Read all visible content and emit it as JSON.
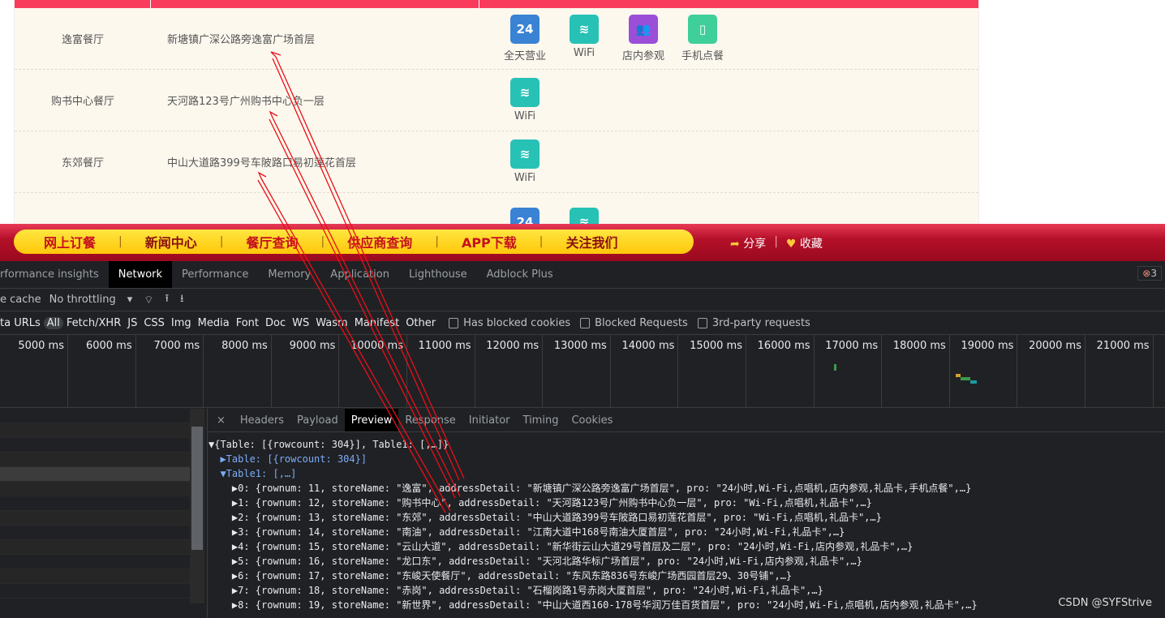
{
  "site": {
    "rows": [
      {
        "name": "逸富餐厅",
        "address": "新塘镇广深公路旁逸富广场首层",
        "features": [
          {
            "label": "全天营业",
            "icon": "24h-icon",
            "color": "#3a82d4"
          },
          {
            "label": "WiFi",
            "icon": "wifi-icon",
            "color": "#27c1b6"
          },
          {
            "label": "店内参观",
            "icon": "people-icon",
            "color": "#9b4fd8"
          },
          {
            "label": "手机点餐",
            "icon": "phone-icon",
            "color": "#3fcf9b"
          }
        ]
      },
      {
        "name": "购书中心餐厅",
        "address": "天河路123号广州购书中心负一层",
        "features": [
          {
            "label": "WiFi",
            "icon": "wifi-icon",
            "color": "#27c1b6"
          }
        ]
      },
      {
        "name": "东郊餐厅",
        "address": "中山大道路399号车陂路口易初莲花首层",
        "features": [
          {
            "label": "WiFi",
            "icon": "wifi-icon",
            "color": "#27c1b6"
          }
        ]
      }
    ],
    "nav": [
      "网上订餐",
      "新闻中心",
      "餐厅查询",
      "供应商查询",
      "APP下载",
      "关注我们"
    ],
    "share": "分享",
    "favorite": "收藏"
  },
  "devtools": {
    "tabs": [
      "rformance insights",
      "Network",
      "Performance",
      "Memory",
      "Application",
      "Lighthouse",
      "Adblock Plus"
    ],
    "active_tab": "Network",
    "error_count": "3",
    "cache_label": "e cache",
    "throttling": "No throttling",
    "filters": [
      "ta URLs",
      "All",
      "Fetch/XHR",
      "JS",
      "CSS",
      "Img",
      "Media",
      "Font",
      "Doc",
      "WS",
      "Wasm",
      "Manifest",
      "Other"
    ],
    "checkboxes": [
      "Has blocked cookies",
      "Blocked Requests",
      "3rd-party requests"
    ],
    "ticks": [
      "5000 ms",
      "6000 ms",
      "7000 ms",
      "8000 ms",
      "9000 ms",
      "10000 ms",
      "11000 ms",
      "12000 ms",
      "13000 ms",
      "14000 ms",
      "15000 ms",
      "16000 ms",
      "17000 ms",
      "18000 ms",
      "19000 ms",
      "20000 ms",
      "21000 ms"
    ],
    "detail_tabs": [
      "Headers",
      "Payload",
      "Preview",
      "Response",
      "Initiator",
      "Timing",
      "Cookies"
    ],
    "active_detail": "Preview",
    "preview": [
      "▼{Table: [{rowcount: 304}], Table1: [,…]}",
      "  ▶Table: [{rowcount: 304}]",
      "  ▼Table1: [,…]",
      "    ▶0: {rownum: 11, storeName: \"逸富\", addressDetail: \"新塘镇广深公路旁逸富广场首层\", pro: \"24小时,Wi-Fi,点唱机,店内参观,礼品卡,手机点餐\",…}",
      "    ▶1: {rownum: 12, storeName: \"购书中心\", addressDetail: \"天河路123号广州购书中心负一层\", pro: \"Wi-Fi,点唱机,礼品卡\",…}",
      "    ▶2: {rownum: 13, storeName: \"东郊\", addressDetail: \"中山大道路399号车陂路口易初莲花首层\", pro: \"Wi-Fi,点唱机,礼品卡\",…}",
      "    ▶3: {rownum: 14, storeName: \"南油\", addressDetail: \"江南大道中168号南油大厦首层\", pro: \"24小时,Wi-Fi,礼品卡\",…}",
      "    ▶4: {rownum: 15, storeName: \"云山大道\", addressDetail: \"新华街云山大道29号首层及二层\", pro: \"24小时,Wi-Fi,店内参观,礼品卡\",…}",
      "    ▶5: {rownum: 16, storeName: \"龙口东\", addressDetail: \"天河北路华标广场首层\", pro: \"24小时,Wi-Fi,店内参观,礼品卡\",…}",
      "    ▶6: {rownum: 17, storeName: \"东峻天使餐厅\", addressDetail: \"东风东路836号东峻广场西园首层29、30号铺\",…}",
      "    ▶7: {rownum: 18, storeName: \"赤岗\", addressDetail: \"石榴岗路1号赤岗大厦首层\", pro: \"24小时,Wi-Fi,礼品卡\",…}",
      "    ▶8: {rownum: 19, storeName: \"新世界\", addressDetail: \"中山大道西160-178号华润万佳百货首层\", pro: \"24小时,Wi-Fi,点唱机,店内参观,礼品卡\",…}"
    ],
    "watermark": "CSDN @SYFStrive"
  }
}
